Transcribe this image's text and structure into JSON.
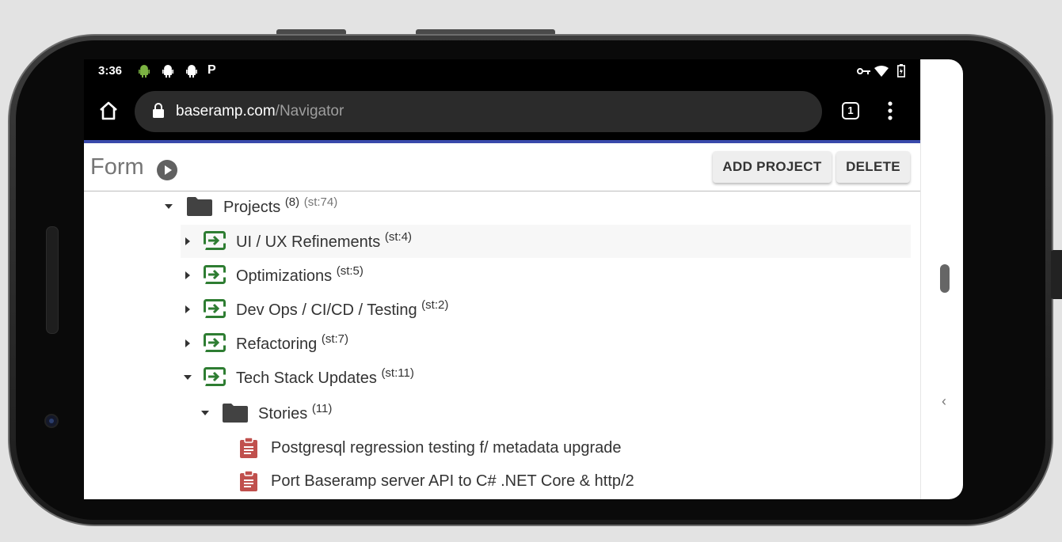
{
  "status_bar": {
    "time": "3:36",
    "left_icons": [
      "android-icon",
      "android-icon",
      "android-icon",
      "p-icon"
    ],
    "right_icons": [
      "key-icon",
      "wifi-icon",
      "battery-icon"
    ]
  },
  "browser": {
    "url_domain": "baseramp.com",
    "url_path": "/Navigator",
    "tab_count": "1"
  },
  "toolbar": {
    "title": "Form",
    "add_project_label": "ADD PROJECT",
    "delete_label": "DELETE"
  },
  "tree": {
    "projects": {
      "label": "Projects",
      "count": "(8)",
      "stat": "(st:74)"
    },
    "items": [
      {
        "label": "UI / UX Refinements",
        "stat": "(st:4)"
      },
      {
        "label": "Optimizations",
        "stat": "(st:5)"
      },
      {
        "label": "Dev Ops / CI/CD / Testing",
        "stat": "(st:2)"
      },
      {
        "label": "Refactoring",
        "stat": "(st:7)"
      },
      {
        "label": "Tech Stack Updates",
        "stat": "(st:11)"
      }
    ],
    "stories": {
      "label": "Stories",
      "count": "(11)"
    },
    "story_items": [
      {
        "label": "Postgresql regression testing f/ metadata upgrade"
      },
      {
        "label": "Port Baseramp server API to C# .NET Core & http/2"
      }
    ]
  },
  "colors": {
    "accent": "#3949ab",
    "project_icon": "#2e7d32",
    "story_icon": "#c0504d",
    "folder": "#424242"
  }
}
